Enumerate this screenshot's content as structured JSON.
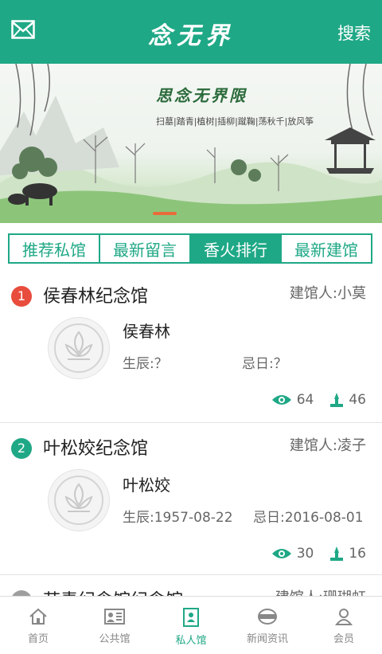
{
  "header": {
    "title": "念无界",
    "search_label": "搜索",
    "mail_icon": "mail-icon"
  },
  "banner": {
    "title": "思念无界限",
    "subtitle": "扫墓|踏青|植树|插柳|蹴鞠|荡秋千|放风筝"
  },
  "tabs": [
    {
      "label": "推荐私馆",
      "active": false
    },
    {
      "label": "最新留言",
      "active": false
    },
    {
      "label": "香火排行",
      "active": true
    },
    {
      "label": "最新建馆",
      "active": false
    }
  ],
  "memorials": [
    {
      "rank": "1",
      "rank_color": "#e84c3d",
      "hall_name": "侯春林纪念馆",
      "builder": "建馆人:小莫",
      "person": "侯春林",
      "birth": "生辰:？",
      "death": "忌日:？",
      "views": "64",
      "incense": "46"
    },
    {
      "rank": "2",
      "rank_color": "#1fa886",
      "hall_name": "叶松姣纪念馆",
      "builder": "建馆人:凌子",
      "person": "叶松姣",
      "birth": "生辰:1957-08-22",
      "death": "忌日:2016-08-01",
      "views": "30",
      "incense": "16"
    }
  ],
  "partial_item": {
    "hall_name": "苏青纪念馆纪念馆",
    "builder": "建馆人:珊瑚虹"
  },
  "tabbar": [
    {
      "label": "首页",
      "icon": "home-icon",
      "active": false
    },
    {
      "label": "公共馆",
      "icon": "public-hall-icon",
      "active": false
    },
    {
      "label": "私人馆",
      "icon": "private-hall-icon",
      "active": true
    },
    {
      "label": "新闻资讯",
      "icon": "news-icon",
      "active": false
    },
    {
      "label": "会员",
      "icon": "member-icon",
      "active": false
    }
  ],
  "colors": {
    "brand": "#1fa886",
    "rank1": "#e84c3d",
    "rank2": "#1fa886"
  }
}
